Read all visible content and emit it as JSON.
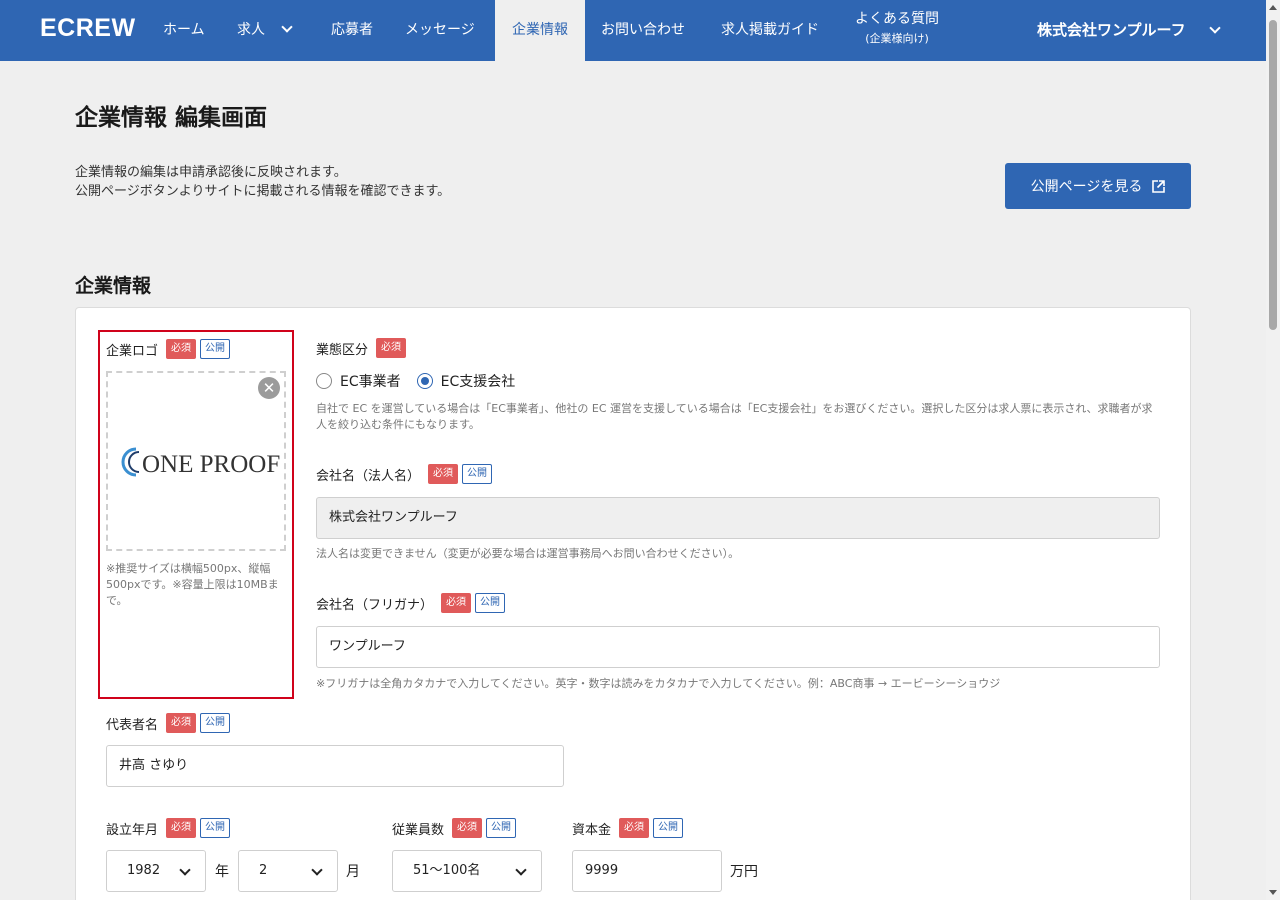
{
  "header": {
    "logo": "ECREW",
    "nav": [
      {
        "label": "ホーム"
      },
      {
        "label": "求人"
      },
      {
        "label": "応募者"
      },
      {
        "label": "メッセージ"
      },
      {
        "label": "企業情報"
      },
      {
        "label": "お問い合わせ"
      },
      {
        "label": "求人掲載ガイド"
      }
    ],
    "faq_label": "よくある質問",
    "faq_sub": "(企業様向け)",
    "company_name": "株式会社ワンプルーフ"
  },
  "page": {
    "title": "企業情報 編集画面",
    "desc_line1": "企業情報の編集は申請承認後に反映されます。",
    "desc_line2": "公開ページボタンよりサイトに掲載される情報を確認できます。",
    "public_button": "公開ページを見る",
    "section_title": "企業情報"
  },
  "badges": {
    "required": "必須",
    "public": "公開"
  },
  "form": {
    "logo": {
      "label": "企業ロゴ",
      "image_text": "ONE PROOF",
      "note": "※推奨サイズは横幅500px、縦幅500pxです。※容量上限は10MBまで。"
    },
    "business_type": {
      "label": "業態区分",
      "options": [
        "EC事業者",
        "EC支援会社"
      ],
      "selected": "EC支援会社",
      "help": "自社で EC を運営している場合は「EC事業者」、他社の EC 運営を支援している場合は「EC支援会社」をお選びください。選択した区分は求人票に表示され、求職者が求人を絞り込む条件にもなります。"
    },
    "company_name": {
      "label": "会社名（法人名）",
      "value": "株式会社ワンプルーフ",
      "help": "法人名は変更できません（変更が必要な場合は運営事務局へお問い合わせください）。"
    },
    "company_kana": {
      "label": "会社名（フリガナ）",
      "value": "ワンプルーフ",
      "help": "※フリガナは全角カタカナで入力してください。英字・数字は読みをカタカナで入力してください。例：ABC商事 → エービーシーショウジ"
    },
    "representative": {
      "label": "代表者名",
      "value": "井高 さゆり"
    },
    "founded": {
      "label": "設立年月",
      "year": "1982",
      "year_unit": "年",
      "month": "2",
      "month_unit": "月"
    },
    "employees": {
      "label": "従業員数",
      "value": "51〜100名"
    },
    "capital": {
      "label": "資本金",
      "value": "9999",
      "unit": "万円"
    }
  },
  "colors": {
    "primary": "#2f66b3",
    "required": "#e05a5a",
    "highlight": "#d0021b"
  }
}
